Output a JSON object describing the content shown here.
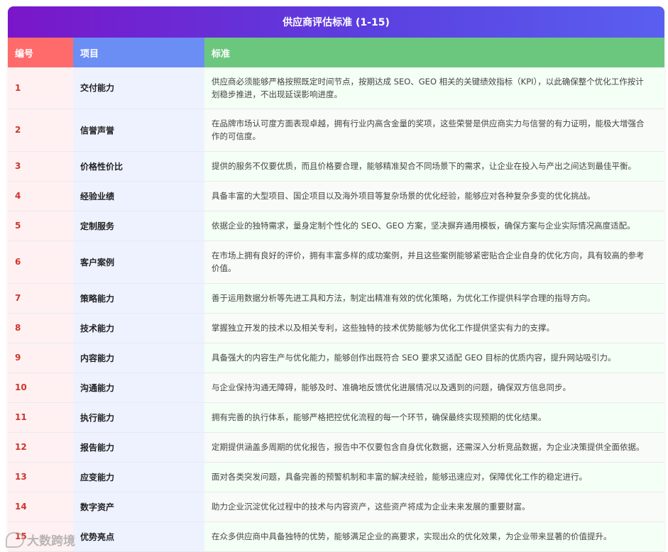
{
  "title": "供应商评估标准 (1-15)",
  "colors": {
    "title_bg_start": "#7a16c9",
    "title_bg_end": "#5a5ff0",
    "num_header": "#ff6b6b",
    "item_header": "#6b8ef5",
    "std_header": "#6cc77e",
    "num_text": "#d0342c"
  },
  "headers": {
    "num": "编号",
    "item": "项目",
    "standard": "标准"
  },
  "rows": [
    {
      "num": "1",
      "item": "交付能力",
      "standard": "供应商必须能够严格按照既定时间节点，按期达成 SEO、GEO 相关的关键绩效指标（KPI），以此确保整个优化工作按计划稳步推进，不出现延误影响进度。"
    },
    {
      "num": "2",
      "item": "信誉声誉",
      "standard": "在品牌市场认可度方面表现卓越，拥有行业内高含金量的奖项，这些荣誉是供应商实力与信誉的有力证明，能极大增强合作的可信度。"
    },
    {
      "num": "3",
      "item": "价格性价比",
      "standard": "提供的服务不仅要优质，而且价格要合理，能够精准契合不同场景下的需求，让企业在投入与产出之间达到最佳平衡。"
    },
    {
      "num": "4",
      "item": "经验业绩",
      "standard": "具备丰富的大型项目、国企项目以及海外项目等复杂场景的优化经验，能够应对各种复杂多变的优化挑战。"
    },
    {
      "num": "5",
      "item": "定制服务",
      "standard": "依据企业的独特需求，量身定制个性化的 SEO、GEO 方案，坚决摒弃通用模板，确保方案与企业实际情况高度适配。"
    },
    {
      "num": "6",
      "item": "客户案例",
      "standard": "在市场上拥有良好的评价，拥有丰富多样的成功案例，并且这些案例能够紧密贴合企业自身的优化方向，具有较高的参考价值。"
    },
    {
      "num": "7",
      "item": "策略能力",
      "standard": "善于运用数据分析等先进工具和方法，制定出精准有效的优化策略，为优化工作提供科学合理的指导方向。"
    },
    {
      "num": "8",
      "item": "技术能力",
      "standard": "掌握独立开发的技术以及相关专利，这些独特的技术优势能够为优化工作提供坚实有力的支撑。"
    },
    {
      "num": "9",
      "item": "内容能力",
      "standard": "具备强大的内容生产与优化能力，能够创作出既符合 SEO 要求又适配 GEO 目标的优质内容，提升网站吸引力。"
    },
    {
      "num": "10",
      "item": "沟通能力",
      "standard": "与企业保持沟通无障碍，能够及时、准确地反馈优化进展情况以及遇到的问题，确保双方信息同步。"
    },
    {
      "num": "11",
      "item": "执行能力",
      "standard": "拥有完善的执行体系，能够严格把控优化流程的每一个环节，确保最终实现预期的优化结果。"
    },
    {
      "num": "12",
      "item": "报告能力",
      "standard": "定期提供涵盖多周期的优化报告，报告中不仅要包含自身优化数据，还需深入分析竞品数据，为企业决策提供全面依据。"
    },
    {
      "num": "13",
      "item": "应变能力",
      "standard": "面对各类突发问题，具备完善的预警机制和丰富的解决经验，能够迅速应对，保障优化工作的稳定进行。"
    },
    {
      "num": "14",
      "item": "数字资产",
      "standard": "助力企业沉淀优化过程中的技术与内容资产，这些资产将成为企业未来发展的重要财富。"
    },
    {
      "num": "15",
      "item": "优势亮点",
      "standard": "在众多供应商中具备独特的优势，能够满足企业的高要求，实现出众的优化效果，为企业带来显著的价值提升。"
    }
  ],
  "watermark": {
    "text": "大数跨境",
    "icon": "chat-bubble-icon"
  }
}
